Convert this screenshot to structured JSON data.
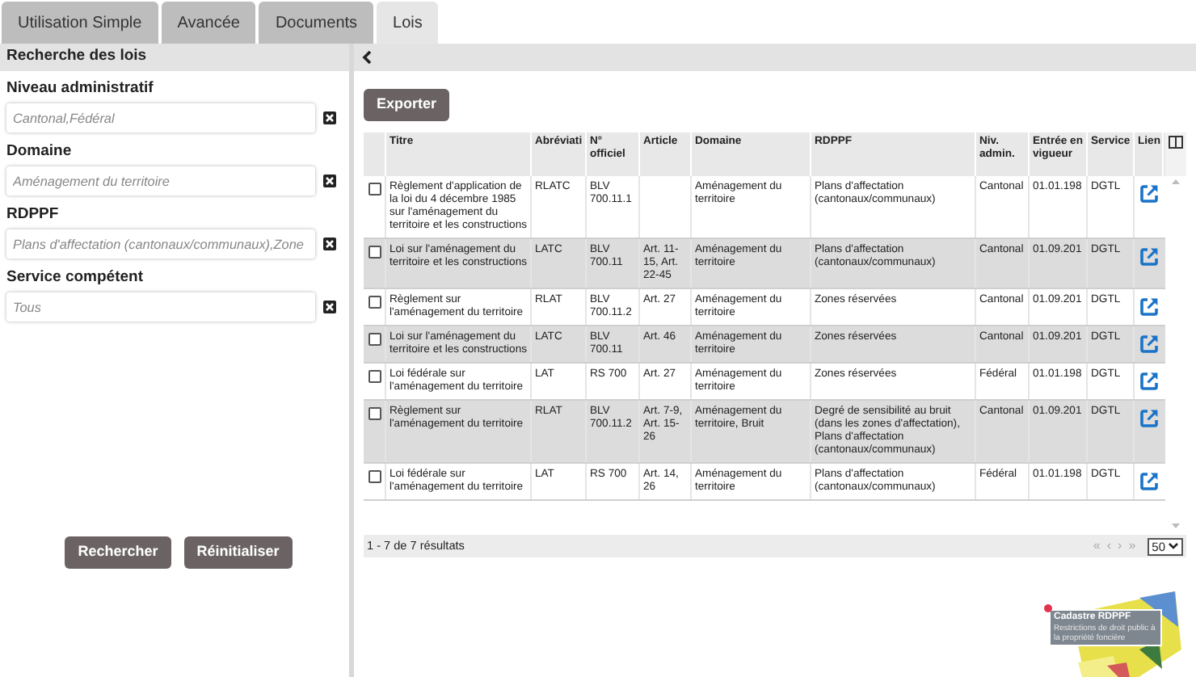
{
  "tabs": [
    {
      "label": "Utilisation Simple",
      "selected": false
    },
    {
      "label": "Avancée",
      "selected": false
    },
    {
      "label": "Documents",
      "selected": false
    },
    {
      "label": "Lois",
      "selected": true
    }
  ],
  "panel_title": "Recherche des lois",
  "filters": [
    {
      "label": "Niveau administratif",
      "placeholder": "Cantonal,Fédéral"
    },
    {
      "label": "Domaine",
      "placeholder": "Aménagement du territoire"
    },
    {
      "label": "RDPPF",
      "placeholder": "Plans d'affectation (cantonaux/communaux),Zone"
    },
    {
      "label": "Service compétent",
      "placeholder": "Tous"
    }
  ],
  "buttons": [
    "Rechercher",
    "Réinitialiser"
  ],
  "export_button": "Exporter",
  "table": {
    "columns": [
      "Titre",
      "Abréviati",
      "N° officiel",
      "Article",
      "Domaine",
      "RDPPF",
      "Niv. admin.",
      "Entrée en vigueur",
      "Service",
      "Lien"
    ],
    "rows": [
      {
        "checked": false,
        "cells": [
          "Règlement d'application de la loi du 4 décembre 1985 sur l'aménagement du territoire et les constructions",
          "RLATC",
          "BLV 700.11.1",
          "",
          "Aménagement du territoire",
          "Plans d'affectation (cantonaux/communaux)",
          "Cantonal",
          "01.01.198",
          "DGTL"
        ]
      },
      {
        "checked": false,
        "cells": [
          "Loi sur l'aménagement du territoire et les constructions",
          "LATC",
          "BLV 700.11",
          "Art. 11-15, Art. 22-45",
          "Aménagement du territoire",
          "Plans d'affectation (cantonaux/communaux)",
          "Cantonal",
          "01.09.201",
          "DGTL"
        ]
      },
      {
        "checked": false,
        "cells": [
          "Règlement sur l'aménagement du territoire",
          "RLAT",
          "BLV 700.11.2",
          "Art. 27",
          "Aménagement du territoire",
          "Zones réservées",
          "Cantonal",
          "01.09.201",
          "DGTL"
        ]
      },
      {
        "checked": false,
        "cells": [
          "Loi sur l'aménagement du territoire et les constructions",
          "LATC",
          "BLV 700.11",
          "Art. 46",
          "Aménagement du territoire",
          "Zones réservées",
          "Cantonal",
          "01.09.201",
          "DGTL"
        ]
      },
      {
        "checked": false,
        "cells": [
          "Loi fédérale sur l'aménagement du territoire",
          "LAT",
          "RS 700",
          "Art. 27",
          "Aménagement du territoire",
          "Zones réservées",
          "Fédéral",
          "01.01.198",
          "DGTL"
        ]
      },
      {
        "checked": false,
        "cells": [
          "Règlement sur l'aménagement du territoire",
          "RLAT",
          "BLV 700.11.2",
          "Art. 7-9, Art. 15-26",
          "Aménagement du territoire, Bruit",
          "Degré de sensibilité au bruit (dans les zones d'affectation), Plans d'affectation (cantonaux/communaux)",
          "Cantonal",
          "01.09.201",
          "DGTL"
        ]
      },
      {
        "checked": false,
        "cells": [
          "Loi fédérale sur l'aménagement du territoire",
          "LAT",
          "RS 700",
          "Art. 14, 26",
          "Aménagement du territoire",
          "Plans d'affectation (cantonaux/communaux)",
          "Fédéral",
          "01.01.198",
          "DGTL"
        ]
      }
    ]
  },
  "footer": {
    "summary": "1 - 7 de 7 résultats",
    "pager": [
      "«",
      "‹",
      "›",
      "»"
    ],
    "page_size": "50"
  },
  "logo": {
    "title": "Cadastre RDPPF",
    "subtitle": "Restrictions de droit public à la propriété foncière"
  }
}
